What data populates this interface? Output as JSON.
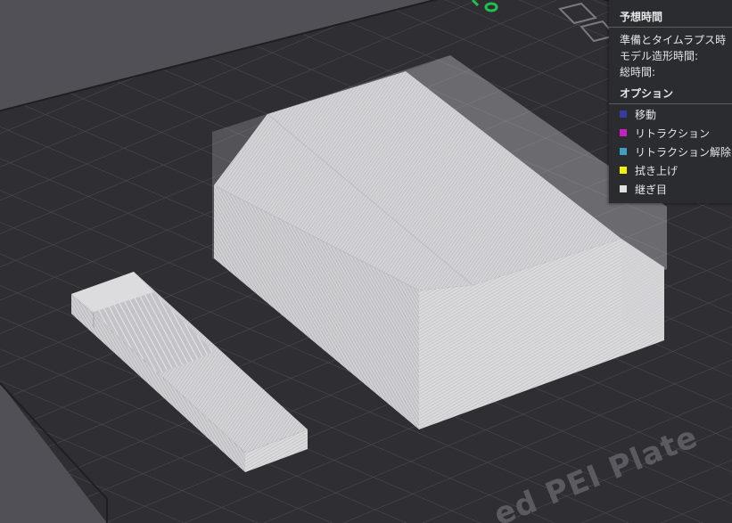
{
  "plate": {
    "label": "ed PEI Plate"
  },
  "estimated_time": {
    "title": "予想時間",
    "rows": [
      {
        "label": "準備とタイムラプス時"
      },
      {
        "label": "モデル造形時間:"
      },
      {
        "label": "総時間:"
      }
    ]
  },
  "options": {
    "title": "オプション",
    "items": [
      {
        "label": "移動",
        "color": "#3a3aa0"
      },
      {
        "label": "リトラクション",
        "color": "#c81fc0"
      },
      {
        "label": "リトラクション解除",
        "color": "#3e9fc2"
      },
      {
        "label": "拭き上げ",
        "color": "#f5f000"
      },
      {
        "label": "継ぎ目",
        "color": "#e0e0e0"
      }
    ]
  }
}
